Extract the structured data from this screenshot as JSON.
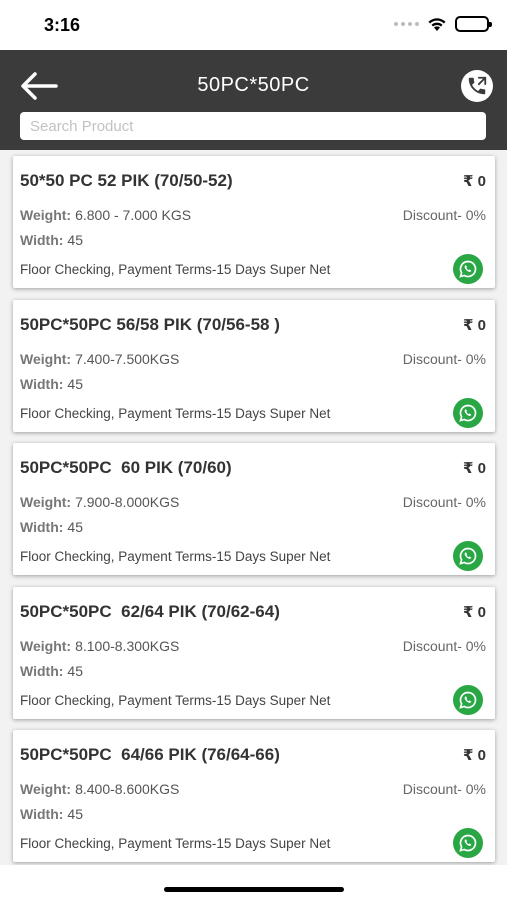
{
  "status_bar": {
    "time": "3:16",
    "icons": [
      "signal-dots-icon",
      "wifi-icon",
      "battery-icon"
    ]
  },
  "header": {
    "title": "50PC*50PC",
    "back_icon": "arrow-left-icon",
    "call_icon": "phone-call-icon",
    "colors": {
      "background": "#3b3b3b",
      "title": "#ffffff"
    }
  },
  "search": {
    "placeholder": "Search Product",
    "value": ""
  },
  "products": [
    {
      "title": "50*50 PC 52 PIK (70/50-52)",
      "price": "₹ 0",
      "weight_label": "Weight:",
      "weight": "6.800 - 7.000 KGS",
      "width_label": "Width:",
      "width": "45",
      "discount": "Discount- 0%",
      "terms": "Floor Checking, Payment Terms-15 Days Super Net"
    },
    {
      "title": "50PC*50PC 56/58 PIK (70/56-58 )",
      "price": "₹ 0",
      "weight_label": "Weight:",
      "weight": "7.400-7.500KGS",
      "width_label": "Width:",
      "width": "45",
      "discount": "Discount- 0%",
      "terms": "Floor Checking, Payment Terms-15 Days Super Net"
    },
    {
      "title": "50PC*50PC  60 PIK (70/60)",
      "price": "₹ 0",
      "weight_label": "Weight:",
      "weight": "7.900-8.000KGS",
      "width_label": "Width:",
      "width": "45",
      "discount": "Discount- 0%",
      "terms": "Floor Checking, Payment Terms-15 Days Super Net"
    },
    {
      "title": "50PC*50PC  62/64 PIK (70/62-64)",
      "price": "₹ 0",
      "weight_label": "Weight:",
      "weight": "8.100-8.300KGS",
      "width_label": "Width:",
      "width": "45",
      "discount": "Discount- 0%",
      "terms": "Floor Checking, Payment Terms-15 Days Super Net"
    },
    {
      "title": "50PC*50PC  64/66 PIK (76/64-66)",
      "price": "₹ 0",
      "weight_label": "Weight:",
      "weight": "8.400-8.600KGS",
      "width_label": "Width:",
      "width": "45",
      "discount": "Discount- 0%",
      "terms": "Floor Checking, Payment Terms-15 Days Super Net"
    }
  ],
  "whatsapp_icon": "whatsapp-icon",
  "colors": {
    "whatsapp": "#2aa745",
    "list_background": "#f2f2f2"
  }
}
